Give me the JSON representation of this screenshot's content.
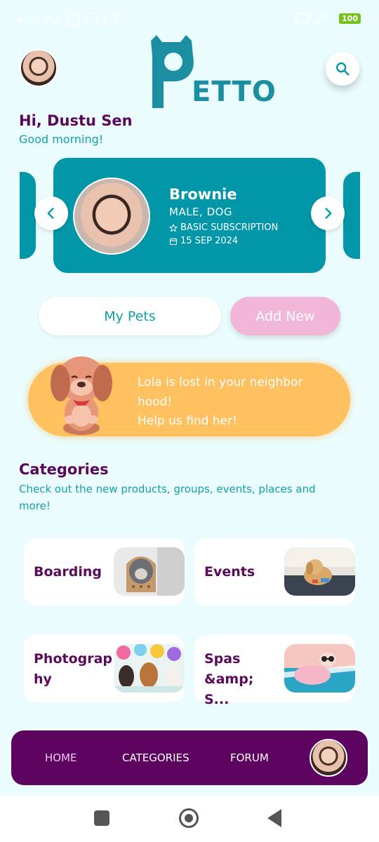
{
  "status_bar": {
    "time": "4:26 PM",
    "battery": "100"
  },
  "app": {
    "logo_text": "ETTO",
    "logo_letter": "P"
  },
  "greeting": {
    "name": "Hi, Dustu Sen",
    "subtitle": "Good  morning!"
  },
  "pet_card": {
    "name": "Brownie",
    "gender_type": "MALE, DOG",
    "subscription": "BASIC SUBSCRIPTION",
    "date": "15 SEP 2024"
  },
  "actions": {
    "my_pets": "My Pets",
    "add_new": "Add New"
  },
  "lost_banner": {
    "line1": "Lola is lost in your neighbor",
    "line2": "hood!",
    "line3": "Help us find her!"
  },
  "categories": {
    "title": "Categories",
    "subtitle": "Check out the new products, groups, events, places and more!",
    "items": [
      {
        "label": "Boarding"
      },
      {
        "label": "Events"
      },
      {
        "label": "Photograp hy"
      },
      {
        "label": "Spas &amp; S..."
      }
    ]
  },
  "bottom_nav": {
    "home": "HOME",
    "categories": "CATEGORIES",
    "forum": "FORUM"
  },
  "colors": {
    "teal": "#0197a8",
    "purple": "#5c0460",
    "orange": "#ffc05f",
    "pink": "#f2b6d9",
    "background": "#eafcfd"
  },
  "icons": [
    "search-icon",
    "chevron-left-icon",
    "chevron-right-icon",
    "star-icon",
    "calendar-icon"
  ]
}
